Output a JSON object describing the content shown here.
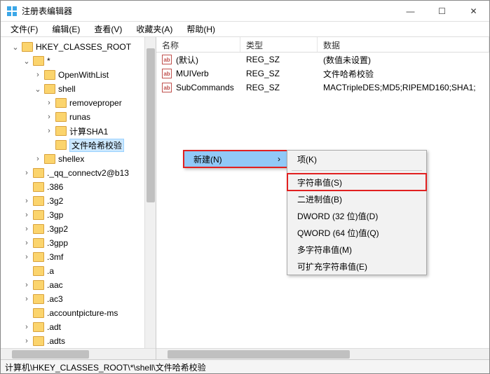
{
  "window": {
    "title": "注册表编辑器"
  },
  "menu": {
    "file": "文件(F)",
    "edit": "编辑(E)",
    "view": "查看(V)",
    "fav": "收藏夹(A)",
    "help": "帮助(H)"
  },
  "tree": {
    "root": "HKEY_CLASSES_ROOT",
    "star": "*",
    "openwithlist": "OpenWithList",
    "shell": "shell",
    "removeproper": "removeproper",
    "runas": "runas",
    "calcsha1": "计算SHA1",
    "filehash": "文件哈希校验",
    "shellex": "shellex",
    "qq": "._qq_connectv2@b13",
    "n386": ".386",
    "n3g2": ".3g2",
    "n3gp": ".3gp",
    "n3gp2": ".3gp2",
    "n3gpp": ".3gpp",
    "n3mf": ".3mf",
    "na": ".a",
    "naac": ".aac",
    "nac3": ".ac3",
    "naccountpic": ".accountpicture-ms",
    "nadt": ".adt",
    "nadts": ".adts"
  },
  "cols": {
    "name": "名称",
    "type": "类型",
    "data": "数据"
  },
  "rows": [
    {
      "name": "(默认)",
      "type": "REG_SZ",
      "data": "(数值未设置)"
    },
    {
      "name": "MUIVerb",
      "type": "REG_SZ",
      "data": "文件哈希校验"
    },
    {
      "name": "SubCommands",
      "type": "REG_SZ",
      "data": "MACTripleDES;MD5;RIPEMD160;SHA1;"
    }
  ],
  "ctx": {
    "new": "新建(N)",
    "key": "项(K)",
    "string": "字符串值(S)",
    "binary": "二进制值(B)",
    "dword": "DWORD (32 位)值(D)",
    "qword": "QWORD (64 位)值(Q)",
    "multistr": "多字符串值(M)",
    "expstr": "可扩充字符串值(E)"
  },
  "status": "计算机\\HKEY_CLASSES_ROOT\\*\\shell\\文件哈希校验",
  "icons": {
    "ab": "ab"
  }
}
